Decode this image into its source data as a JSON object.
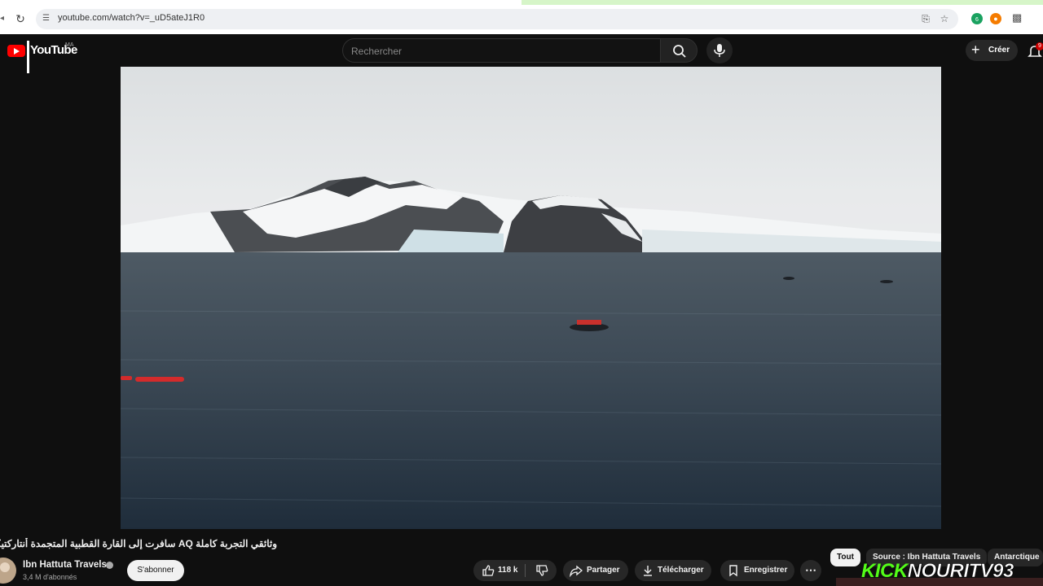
{
  "browser": {
    "url": "youtube.com/watch?v=_uD5ateJ1R0",
    "extension_badge": "6"
  },
  "header": {
    "logo_text": "YouTube",
    "country_code": "MA",
    "search_placeholder": "Rechercher",
    "create_label": "Créer",
    "notifications_count": "9"
  },
  "video": {
    "title": "وثائقي التجربة كاملة AQ سافرت إلى القارة القطبية المتجمدة أنتاركتيكا",
    "channel_name": "Ibn Hattuta Travels",
    "subscribers": "3,4 M d'abonnés",
    "subscribe_label": "S'abonner"
  },
  "actions": {
    "likes": "118 k",
    "share_label": "Partager",
    "download_label": "Télécharger",
    "save_label": "Enregistrer"
  },
  "chips": [
    "Tout",
    "Source : Ibn Hattuta Travels",
    "Antarctique"
  ],
  "overlay": {
    "kick_word": "KICK",
    "handle": "NOURITV93"
  },
  "colors": {
    "background": "#0f0f0f",
    "brand_red": "#ff0000",
    "kick_green": "#53fc18"
  }
}
